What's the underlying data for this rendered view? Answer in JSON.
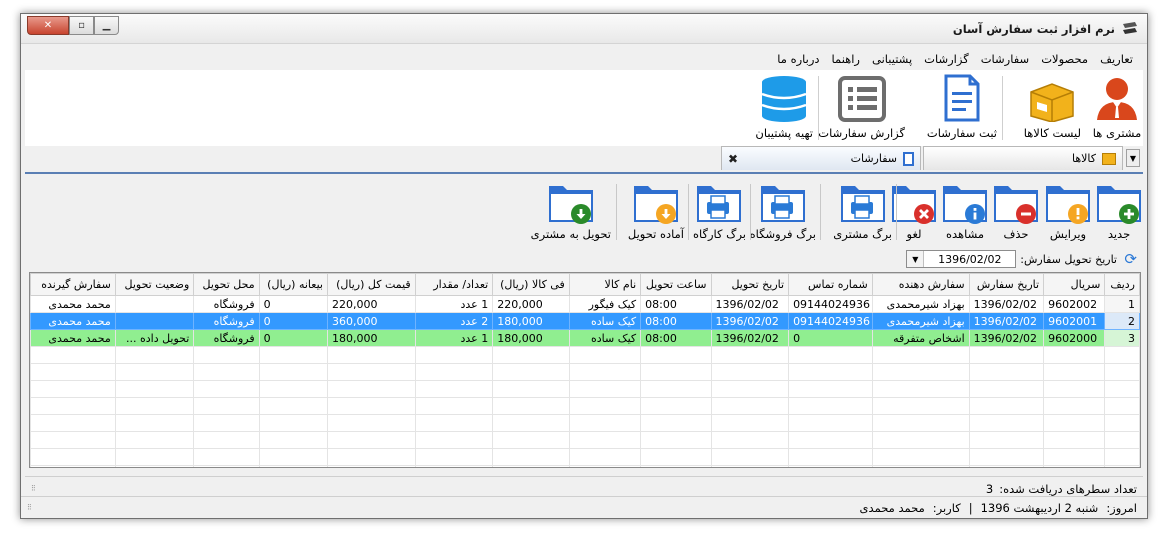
{
  "window": {
    "title": "نرم افزار ثبت سفارش آسان"
  },
  "menu": [
    "تعاریف",
    "محصولات",
    "سفارشات",
    "گزارشات",
    "پشتیبانی",
    "راهنما",
    "درباره ما"
  ],
  "ribbon": [
    {
      "label": "مشتری ها",
      "icon": "customer-icon"
    },
    {
      "label": "لیست کالاها",
      "icon": "box-icon"
    },
    {
      "label": "ثبت سفارشات",
      "icon": "document-icon"
    },
    {
      "label": "گزارش سفارشات",
      "icon": "list-icon"
    },
    {
      "label": "تهیه پشتیبان",
      "icon": "database-icon"
    }
  ],
  "tabs": [
    {
      "label": "کالاها"
    },
    {
      "label": "سفارشات"
    }
  ],
  "toolbar": [
    {
      "label": "جدید",
      "badge": "plus",
      "color": "#2a8a2a"
    },
    {
      "label": "ویرایش",
      "badge": "!",
      "color": "#f5a623"
    },
    {
      "label": "حذف",
      "badge": "minus",
      "color": "#d9302b"
    },
    {
      "label": "مشاهده",
      "badge": "i",
      "color": "#2a7ad6"
    },
    {
      "label": "لغو",
      "badge": "x",
      "color": "#d9302b"
    },
    {
      "label": "برگ مشتری",
      "badge": "printer",
      "color": "#2a7ad6"
    },
    {
      "label": "برگ فروشگاه",
      "badge": "printer",
      "color": "#2a7ad6"
    },
    {
      "label": "برگ کارگاه",
      "badge": "printer",
      "color": "#2a7ad6"
    },
    {
      "label": "آماده تحویل",
      "badge": "down",
      "color": "#f5a623"
    },
    {
      "label": "تحویل به مشتری",
      "badge": "down",
      "color": "#2a8a2a"
    }
  ],
  "filter": {
    "label": "تاریخ تحویل سفارش:",
    "value": "1396/02/02"
  },
  "grid": {
    "columns": [
      "ردیف",
      "سریال",
      "تاریخ سفارش",
      "سفارش دهنده",
      "شماره تماس",
      "تاریخ تحویل",
      "ساعت تحویل",
      "نام کالا",
      "فی کالا (ریال)",
      "تعداد/ مقدار",
      "قیمت کل (ریال)",
      "بیعانه (ریال)",
      "محل تحویل",
      "وضعیت تحویل",
      "سفارش گیرنده"
    ],
    "rows": [
      [
        "1",
        "9602002",
        "1396/02/02",
        "بهزاد شیرمحمدی",
        "09144024936",
        "1396/02/02",
        "08:00",
        "کیک فیگور",
        "220,000",
        "1 عدد",
        "220,000",
        "0",
        "فروشگاه",
        "",
        "محمد محمدی"
      ],
      [
        "2",
        "9602001",
        "1396/02/02",
        "بهزاد شیرمحمدی",
        "09144024936",
        "1396/02/02",
        "08:00",
        "کیک ساده",
        "180,000",
        "2 عدد",
        "360,000",
        "0",
        "فروشگاه",
        "",
        "محمد محمدی"
      ],
      [
        "3",
        "9602000",
        "1396/02/02",
        "اشخاص متفرقه",
        "0",
        "1396/02/02",
        "08:00",
        "کیک ساده",
        "180,000",
        "1 عدد",
        "180,000",
        "0",
        "فروشگاه",
        "تحویل داده ...",
        "محمد محمدی"
      ]
    ]
  },
  "status": {
    "rows_label": "تعداد سطرهای دریافت شده:",
    "rows_count": "3",
    "today_label": "امروز:",
    "today_value": "شنبه 2 اردیبهشت 1396",
    "separator": "|",
    "user_label": "کاربر:",
    "user_value": "محمد محمدی"
  }
}
